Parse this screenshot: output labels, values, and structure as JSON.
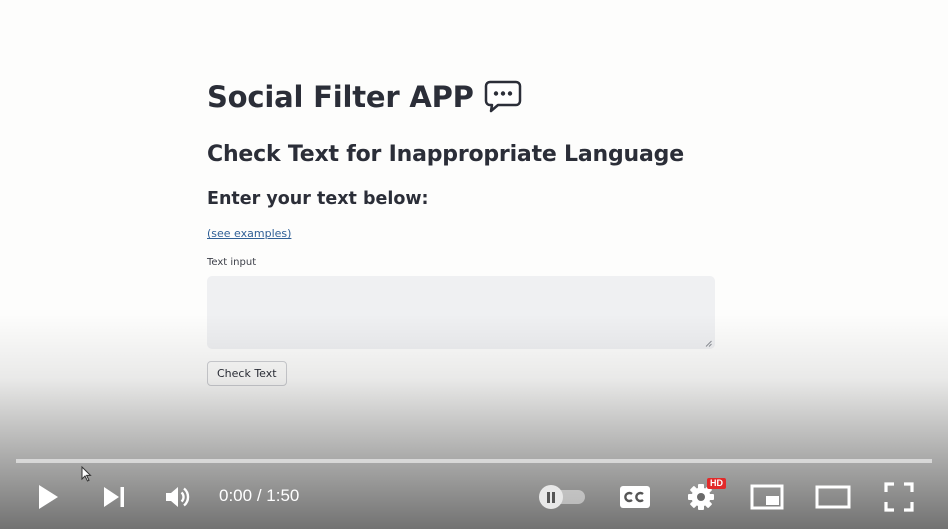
{
  "app": {
    "title": "Social Filter APP",
    "title_icon": "speech-balloon-icon",
    "subtitle": "Check Text for Inappropriate Language",
    "prompt": "Enter your text below:",
    "examples_link": "(see examples)",
    "input_label": "Text input",
    "input_value": "",
    "check_button": "Check Text"
  },
  "player": {
    "current_time": "0:00",
    "duration": "1:50",
    "time_display": "0:00 / 1:50",
    "progress": 0,
    "hd_badge": "HD",
    "autoplay": "paused",
    "controls": [
      "play-icon",
      "next-icon",
      "volume-icon",
      "autoplay-toggle",
      "captions-icon",
      "settings-icon",
      "miniplayer-icon",
      "theater-icon",
      "fullscreen-icon"
    ],
    "colors": {
      "progress_played": "#ff0000",
      "hd_badge": "#e22a2a"
    }
  }
}
